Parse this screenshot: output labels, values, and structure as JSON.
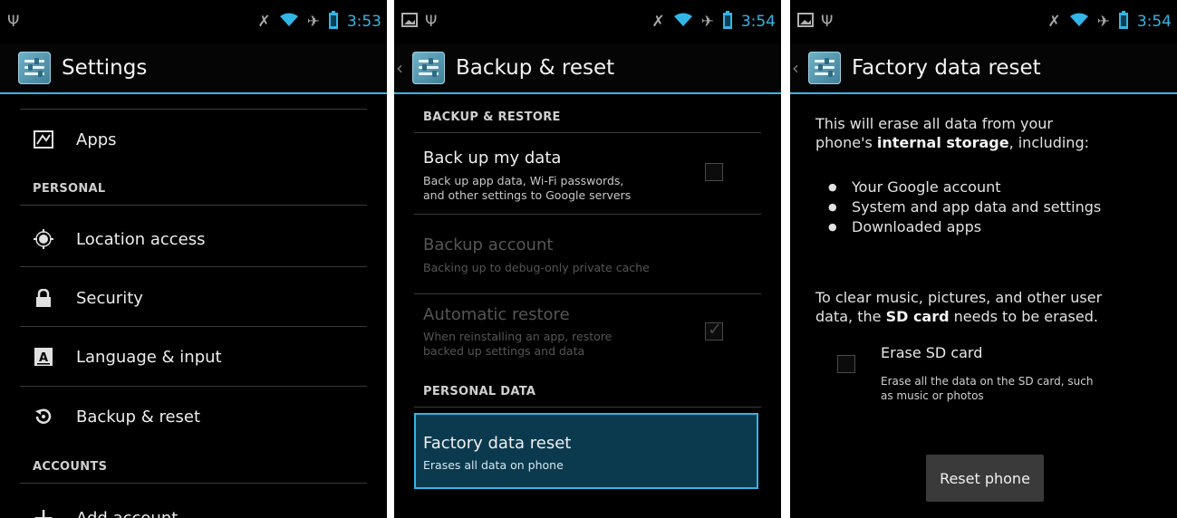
{
  "colors": {
    "accent": "#33b5e5",
    "background": "#000000",
    "highlight": "#0b3a4f"
  },
  "screens": [
    {
      "statusbar": {
        "time": "3:53"
      },
      "actionbar": {
        "title": "Settings"
      },
      "items": [
        {
          "type": "item",
          "label": "Apps",
          "icon": "apps-icon"
        },
        {
          "type": "category",
          "label": "PERSONAL"
        },
        {
          "type": "item",
          "label": "Location access",
          "icon": "location-icon"
        },
        {
          "type": "item",
          "label": "Security",
          "icon": "lock-icon"
        },
        {
          "type": "item",
          "label": "Language & input",
          "icon": "keyboard-icon"
        },
        {
          "type": "item",
          "label": "Backup & reset",
          "icon": "backup-restore-icon"
        },
        {
          "type": "category",
          "label": "ACCOUNTS"
        },
        {
          "type": "item",
          "label": "Add account",
          "icon": "add-icon"
        }
      ]
    },
    {
      "statusbar": {
        "time": "3:54"
      },
      "actionbar": {
        "title": "Backup & reset"
      },
      "backup_restore_header": "BACKUP & RESTORE",
      "backup_my_data": {
        "title": "Back up my data",
        "summary_1": "Back up app data, Wi-Fi passwords,",
        "summary_2": "and other settings to Google servers",
        "checked": false
      },
      "backup_account": {
        "title": "Backup account",
        "summary": "Backing up to debug-only private cache",
        "enabled": false
      },
      "automatic_restore": {
        "title": "Automatic restore",
        "summary_1": "When reinstalling an app, restore",
        "summary_2": "backed up settings and data",
        "checked": true,
        "enabled": false
      },
      "personal_data_header": "PERSONAL DATA",
      "factory_reset": {
        "title": "Factory data reset",
        "summary": "Erases all data on phone",
        "selected": true
      }
    },
    {
      "statusbar": {
        "time": "3:54"
      },
      "actionbar": {
        "title": "Factory data reset"
      },
      "intro_1": "This will erase all data from your",
      "intro_2_pre": "phone's ",
      "intro_2_bold": "internal storage",
      "intro_2_post": ", including:",
      "bullets": [
        "Your Google account",
        "System and app data and settings",
        "Downloaded apps"
      ],
      "sd_1": "To clear music, pictures, and other user",
      "sd_2_pre": "data, the ",
      "sd_2_bold": "SD card",
      "sd_2_post": " needs to be erased.",
      "erase_sd": {
        "title": "Erase SD card",
        "summary_1": "Erase all the data on the SD card, such",
        "summary_2": "as music or photos",
        "checked": false
      },
      "reset_button": "Reset phone"
    }
  ]
}
